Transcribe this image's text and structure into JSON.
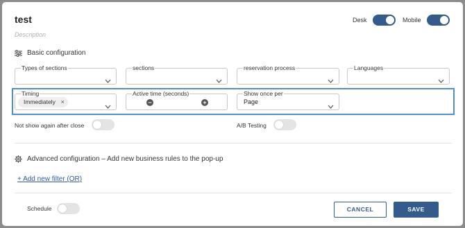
{
  "header": {
    "title": "test",
    "description_placeholder": "Description",
    "desk_label": "Desk",
    "desk_on": true,
    "mobile_label": "Mobile",
    "mobile_on": true
  },
  "basic": {
    "heading": "Basic configuration",
    "fields": {
      "types_of_sections": "Types of sections",
      "sections": "sections",
      "reservation_process": "reservation process",
      "languages": "Languages"
    },
    "timing": {
      "label": "Timing",
      "chip": "Immediately",
      "chip_remove": "×"
    },
    "active_time": {
      "label": "Active time (seconds)",
      "decrement": "−",
      "increment": "+"
    },
    "show_once": {
      "label": "Show once per",
      "value": "Page"
    },
    "not_show_again": {
      "label": "Not show again after close",
      "on": false
    },
    "ab_testing": {
      "label": "A/B Testing",
      "on": false
    }
  },
  "advanced": {
    "heading": "Advanced configuration – Add new business rules to the pop-up",
    "add_filter": "+ Add new filter (OR)"
  },
  "footer": {
    "schedule_label": "Schedule",
    "schedule_on": false,
    "cancel": "CANCEL",
    "save": "SAVE"
  },
  "colors": {
    "accent": "#345b8e",
    "focus_border": "#4a8fd8",
    "link": "#2d5aa0"
  }
}
